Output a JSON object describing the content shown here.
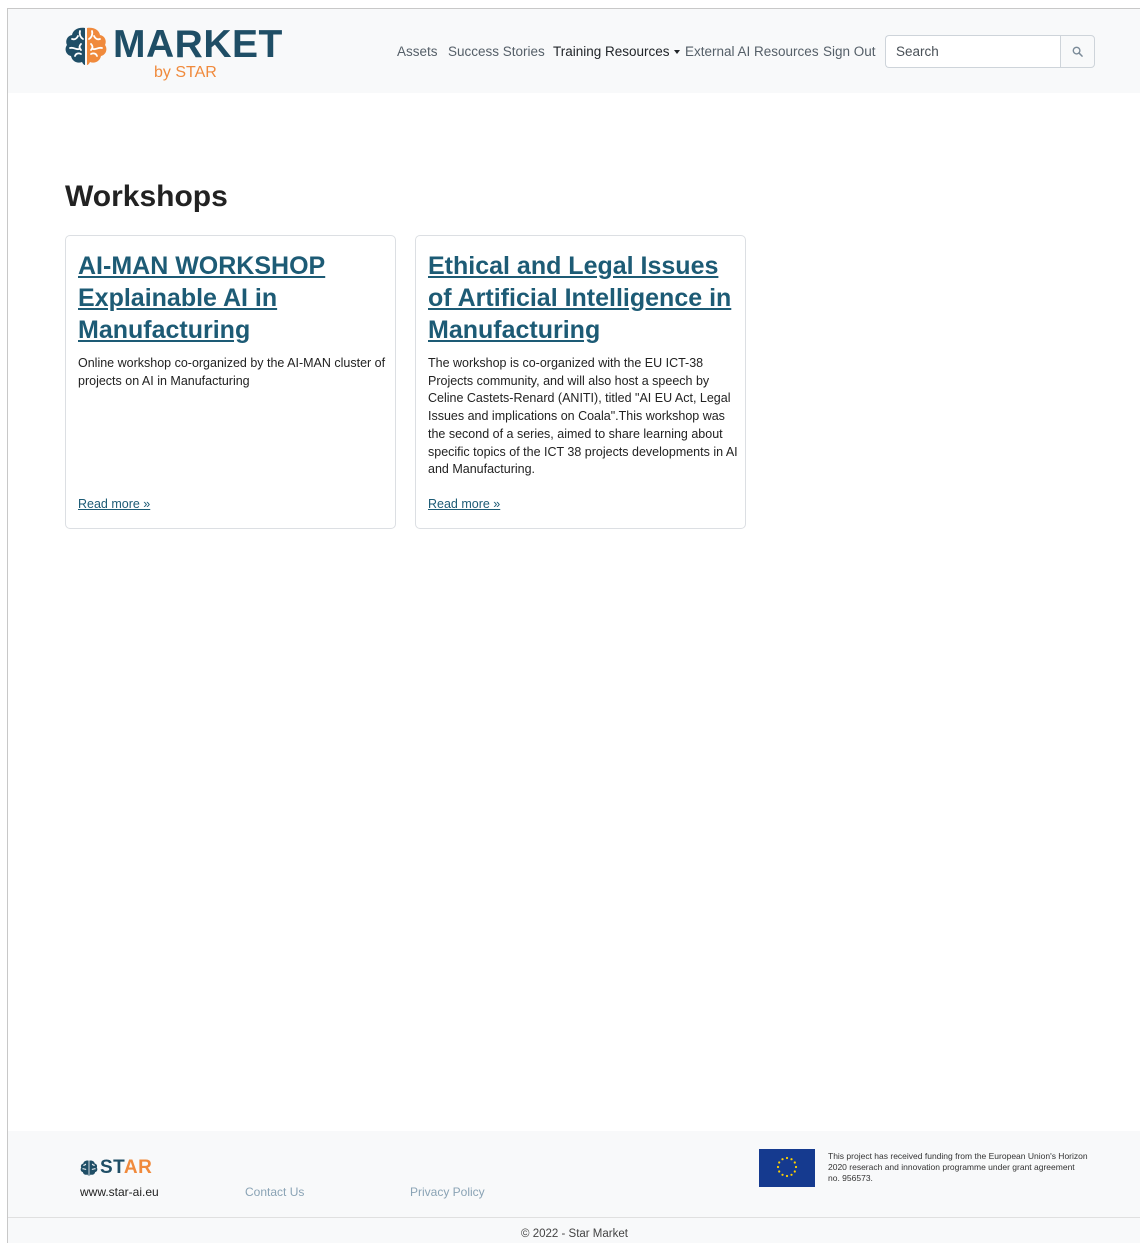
{
  "header": {
    "brand_word": "MARKET",
    "brand_sub": "by STAR",
    "nav": [
      {
        "label": "Assets"
      },
      {
        "label": "Success Stories"
      },
      {
        "label": "Training Resources"
      },
      {
        "label": "External AI Resources"
      },
      {
        "label": "Sign Out"
      }
    ],
    "search_placeholder": "Search",
    "icons": {
      "logo": "brain-icon",
      "search": "search-icon",
      "dropdown": "chevron-down-icon"
    }
  },
  "main": {
    "heading": "Workshops",
    "cards": [
      {
        "title": "AI-MAN WORKSHOP Explainable AI in Manufacturing",
        "description": "Online workshop co-organized by the AI-MAN cluster of projects on AI in Manufacturing",
        "read_more": "Read more »"
      },
      {
        "title": "Ethical and Legal Issues of Artificial Intelligence in Manufacturing",
        "description": "The workshop is co-organized with the EU ICT-38 Projects community, and will also host a speech by Celine Castets-Renard (ANITI), titled \"AI EU Act, Legal Issues and implications on Coala\".This workshop was the second of a series, aimed to share learning about specific topics of the ICT 38 projects developments in AI and Manufacturing.",
        "read_more": "Read more »"
      }
    ]
  },
  "footer": {
    "logo_text_a": "ST",
    "logo_text_b": "AR",
    "site": "www.star-ai.eu",
    "contact": "Contact Us",
    "privacy": "Privacy Policy",
    "funding": "This project has received funding from the European Union's Horizon 2020 reserach and innovation programme under grant agreement no. 956573.",
    "copyright": "© 2022 - Star Market"
  },
  "colors": {
    "brand_dark": "#1f4e66",
    "brand_orange": "#f08a3c",
    "link": "#1d5b75",
    "eu_blue": "#153a8f"
  }
}
